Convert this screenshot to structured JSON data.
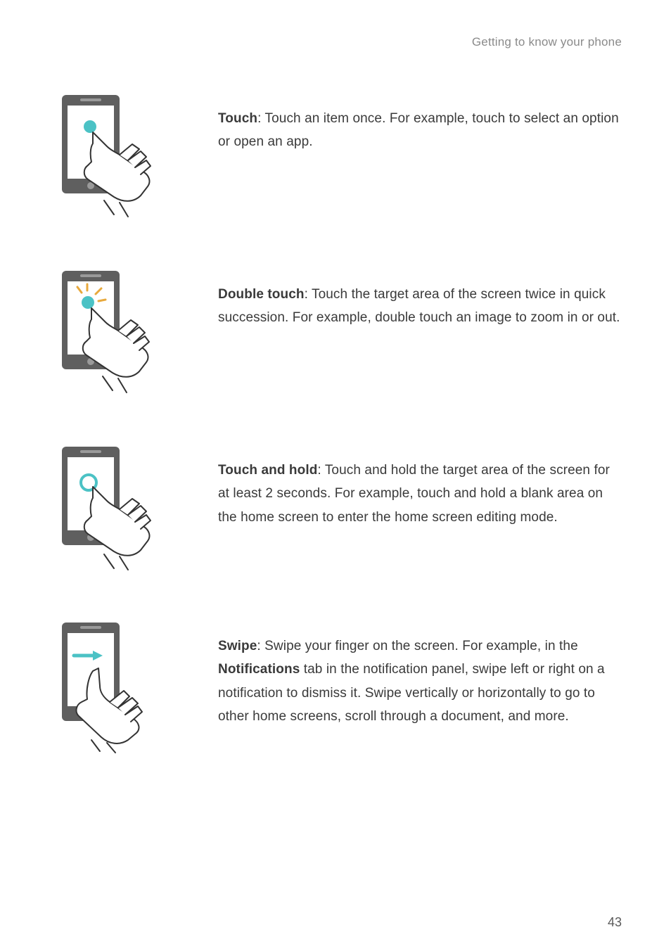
{
  "header": "Getting to know your phone",
  "gestures": [
    {
      "term": "Touch",
      "body": ": Touch an item once. For example, touch to select an option or open an app."
    },
    {
      "term": "Double touch",
      "body": ": Touch the target area of the screen twice in quick succession. For example, double touch an image to zoom in or out."
    },
    {
      "term": "Touch and hold",
      "body": ": Touch and hold the target area of the screen for at least 2 seconds. For example, touch and hold a blank area on the home screen to enter the home screen editing mode."
    },
    {
      "term": "Swipe",
      "body_parts": [
        ": Swipe your finger on the screen. For example, in the ",
        "Notifications",
        " tab in the notification panel, swipe left or right on a notification to dismiss it. Swipe vertically or horizontally to go to other home screens, scroll through a document, and more."
      ]
    }
  ],
  "page_number": "43"
}
